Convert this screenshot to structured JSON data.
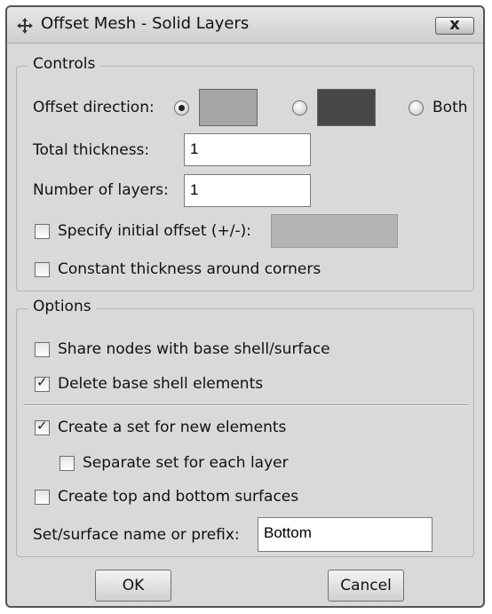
{
  "window": {
    "title": "Offset Mesh - Solid Layers",
    "close_label": "x"
  },
  "controls": {
    "legend": "Controls",
    "offset_direction_label": "Offset direction:",
    "direction_options": [
      {
        "selected": true,
        "swatch_color": "#a6a6a6"
      },
      {
        "selected": false,
        "swatch_color": "#4a474a"
      }
    ],
    "both_label": "Both",
    "both_selected": false,
    "total_thickness_label": "Total thickness:",
    "total_thickness_value": "1",
    "num_layers_label": "Number of layers:",
    "num_layers_value": "1",
    "initial_offset_label": "Specify initial offset (+/-):",
    "initial_offset_checked": false,
    "initial_offset_value": "",
    "constant_thickness_label": "Constant thickness around corners",
    "constant_thickness_checked": false
  },
  "options": {
    "legend": "Options",
    "share_nodes_label": "Share nodes with base shell/surface",
    "share_nodes_checked": false,
    "delete_shell_label": "Delete base shell elements",
    "delete_shell_checked": true,
    "create_set_label": "Create a set for new elements",
    "create_set_checked": true,
    "separate_set_label": "Separate set for each layer",
    "separate_set_checked": false,
    "create_surfaces_label": "Create top and bottom surfaces",
    "create_surfaces_checked": false,
    "name_prefix_label": "Set/surface name or prefix:",
    "name_prefix_value": "Bottom"
  },
  "buttons": {
    "ok_label": "OK",
    "cancel_label": "Cancel"
  },
  "check_glyph": "✓"
}
